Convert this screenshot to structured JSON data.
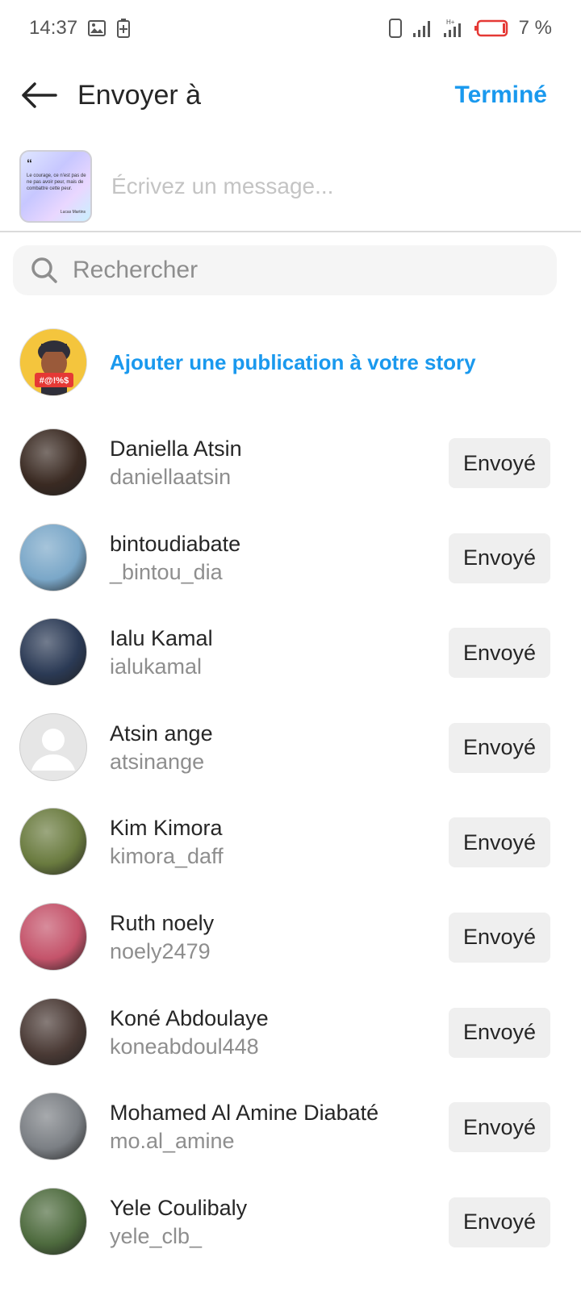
{
  "status_bar": {
    "time": "14:37",
    "battery": "7 %"
  },
  "header": {
    "title": "Envoyer à",
    "done": "Terminé"
  },
  "post": {
    "quote_mark": "“",
    "text": "Le courage, ce n'est pas de ne pas avoir peur, mais de combattre cette peur.",
    "signature": "Lucas Martins"
  },
  "message": {
    "placeholder": "Écrivez un message..."
  },
  "search": {
    "placeholder": "Rechercher"
  },
  "story": {
    "label": "Ajouter une publication à votre story",
    "badge": "#@!%$"
  },
  "contacts": [
    {
      "name": "Daniella Atsin",
      "username": "daniellaatsin",
      "button": "Envoyé",
      "color": "#3a2a22"
    },
    {
      "name": "bintoudiabate",
      "username": "_bintou_dia",
      "button": "Envoyé",
      "color": "#7aa7c8"
    },
    {
      "name": "Ialu Kamal",
      "username": "ialukamal",
      "button": "Envoyé",
      "color": "#2b3a55"
    },
    {
      "name": "Atsin ange",
      "username": "atsinange",
      "button": "Envoyé",
      "color": "#d9d9d9"
    },
    {
      "name": "Kim Kimora",
      "username": "kimora_daff",
      "button": "Envoyé",
      "color": "#6a7b3f"
    },
    {
      "name": "Ruth noely",
      "username": "noely2479",
      "button": "Envoyé",
      "color": "#c4536a"
    },
    {
      "name": "Koné Abdoulaye",
      "username": "koneabdoul448",
      "button": "Envoyé",
      "color": "#4a3a35"
    },
    {
      "name": "Mohamed Al Amine Diabaté",
      "username": "mo.al_amine",
      "button": "Envoyé",
      "color": "#7b7f84"
    },
    {
      "name": "Yele Coulibaly",
      "username": "yele_clb_",
      "button": "Envoyé",
      "color": "#4e6b3e"
    }
  ]
}
